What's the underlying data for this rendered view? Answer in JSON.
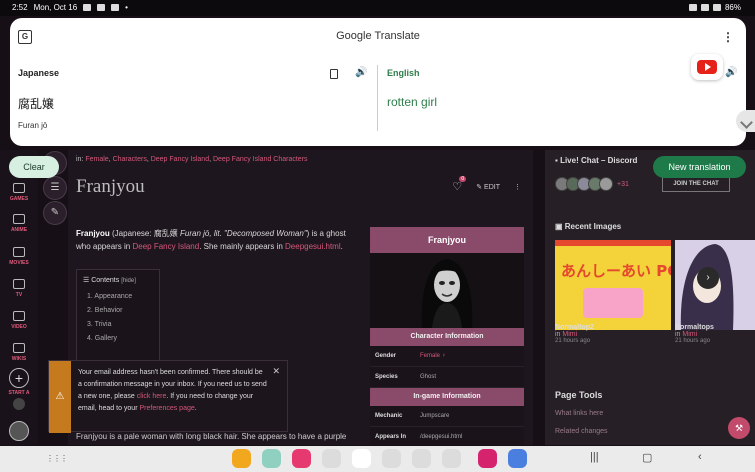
{
  "status_bar": {
    "time": "2:52",
    "date": "Mon, Oct 16",
    "battery": "86%"
  },
  "translate": {
    "app_name": "Google Translate",
    "source_language": "Japanese",
    "target_language": "English",
    "source_text": "腐乱嬢",
    "romanization": "Furan jō",
    "translated_text": "rotten girl",
    "clear_label": "Clear",
    "new_translation_label": "New translation"
  },
  "left_rail": {
    "items": [
      "GAMES",
      "ANIME",
      "MOVIES",
      "TV",
      "VIDEO",
      "WIKIS",
      "START A"
    ]
  },
  "article": {
    "categories_prefix": "in:",
    "categories": [
      "Female",
      "Characters",
      "Deep Fancy Island",
      "Deep Fancy Island Characters"
    ],
    "title": "Franjyou",
    "comment_count": "0",
    "edit_label": "EDIT",
    "intro": {
      "name": "Franjyou",
      "paren_open": " (Japanese: ",
      "jp": "腐乱嬢",
      "romaji": " Furan jō, lit. \"Decomposed Woman\"",
      "paren_close": ") is a ghost who appears in ",
      "link1": "Deep Fancy Island",
      "mid": ". She mainly appears in ",
      "link2": "Deepgesui.html",
      "end": "."
    },
    "toc": {
      "heading": "Contents",
      "hide_label": "[hide]",
      "items": [
        "1. Appearance",
        "2. Behavior",
        "3. Trivia",
        "4. Gallery"
      ]
    },
    "bottom_line": "Franjyou is a pale woman with long black hair. She appears to have a purple"
  },
  "infobox": {
    "title": "Franjyou",
    "section1": "Character Information",
    "rows1": [
      {
        "key": "Gender",
        "value": "Female ♀"
      },
      {
        "key": "Species",
        "value": "Ghost"
      }
    ],
    "section2": "In-game Information",
    "rows2": [
      {
        "key": "Mechanic",
        "value": "Jumpscare"
      },
      {
        "key": "Appears In",
        "value": "/deepgesui.html"
      }
    ]
  },
  "notice": {
    "line1": "Your email address hasn't been confirmed. There should be a confirmation message in your inbox. If you need us to send a new one, please ",
    "link1": "click here",
    "line2": ". If you need to change your email, head to your ",
    "link2": "Preferences page",
    "line3": "."
  },
  "right_rail": {
    "chat_heading": "Live! Chat – Discord",
    "online_extra": "+31",
    "join_label": "JOIN THE CHAT",
    "recent_heading": "Recent Images",
    "recent_images": [
      {
        "name": "Normaltop2",
        "in_prefix": "in",
        "wiki": "Mimi",
        "time": "21 hours ago",
        "image_text": "あんしーあい PC版"
      },
      {
        "name": "Normaltops",
        "in_prefix": "in",
        "wiki": "Mimi",
        "time": "21 hours ago",
        "image_text": ""
      }
    ],
    "tools_heading": "Page Tools",
    "tools": [
      "What links here",
      "Related changes"
    ]
  },
  "colors": {
    "accent_pink": "#d4587a",
    "infobox_header": "#8a4a6a",
    "translate_green": "#1e7a48"
  }
}
